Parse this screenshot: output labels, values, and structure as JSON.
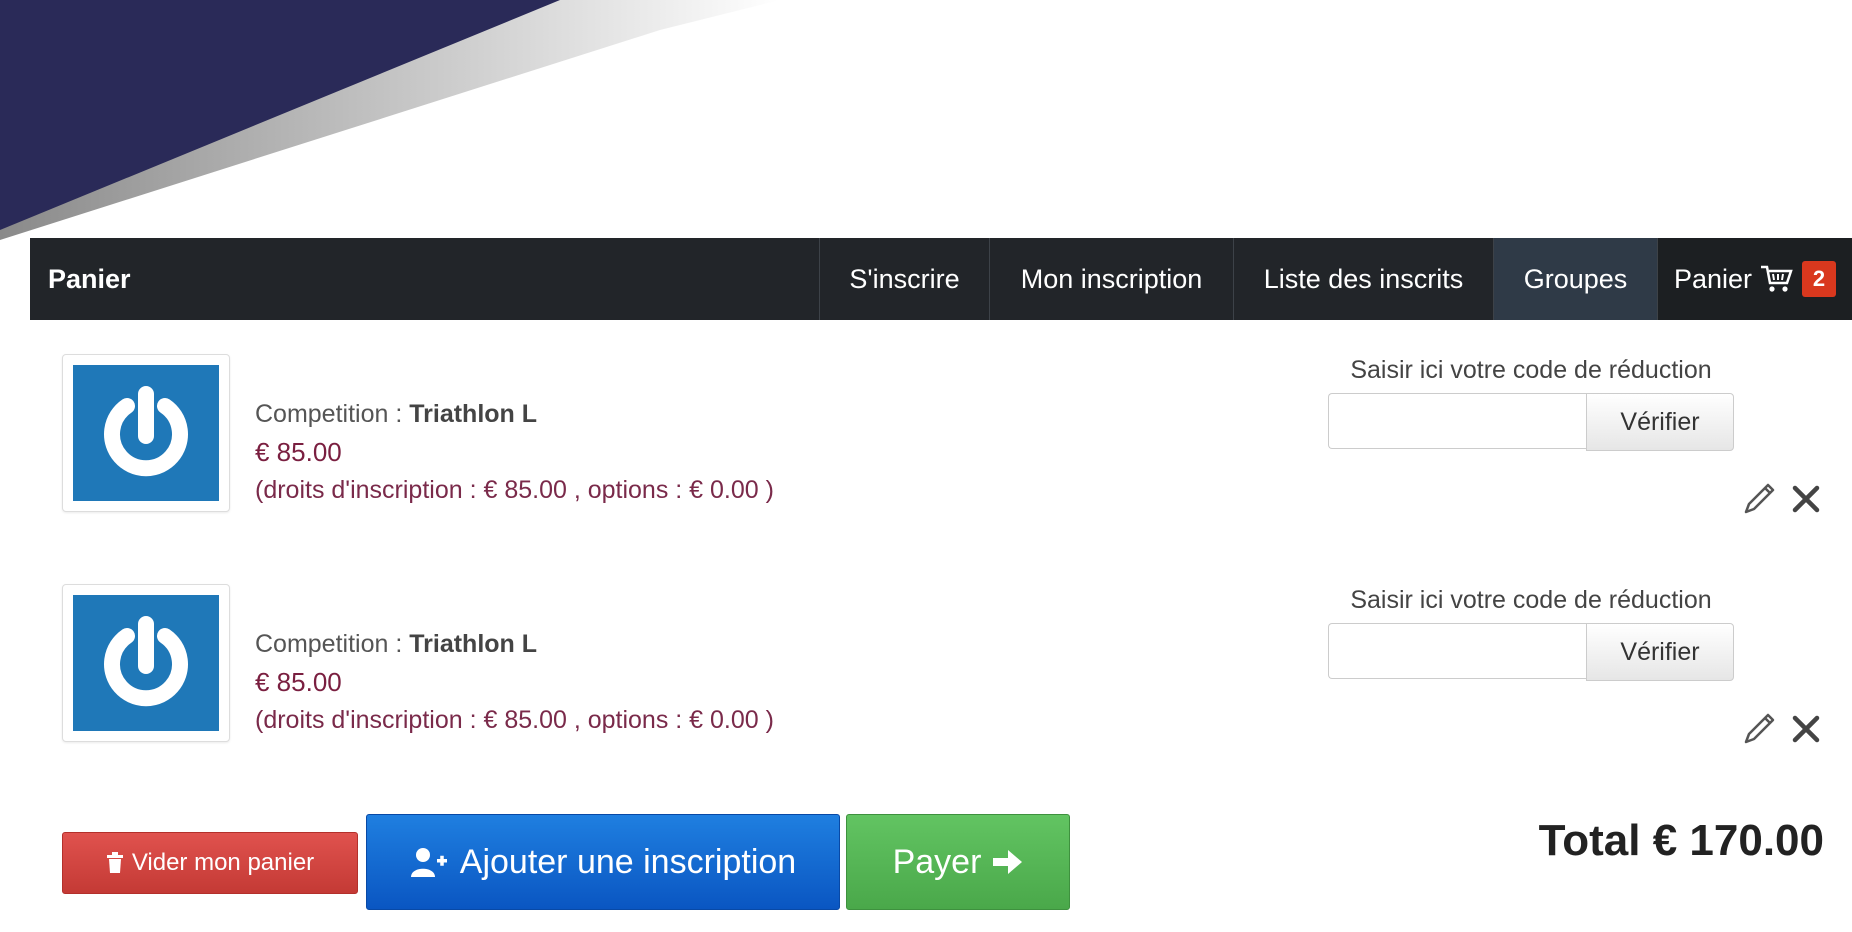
{
  "navbar": {
    "brand": "Panier",
    "items": [
      {
        "label": "S'inscrire"
      },
      {
        "label": "Mon inscription"
      },
      {
        "label": "Liste des inscrits"
      },
      {
        "label": "Groupes"
      },
      {
        "label": "Panier",
        "badge": "2"
      }
    ]
  },
  "cart": {
    "items": [
      {
        "competition_prefix": "Competition :",
        "competition_name": "Triathlon L",
        "price": "€ 85.00",
        "details": "(droits d'inscription : € 85.00 , options : € 0.00 )",
        "discount_label": "Saisir ici votre code de réduction",
        "discount_value": "",
        "verify_label": "Vérifier"
      },
      {
        "competition_prefix": "Competition :",
        "competition_name": "Triathlon L",
        "price": "€ 85.00",
        "details": "(droits d'inscription : € 85.00 , options : € 0.00 )",
        "discount_label": "Saisir ici votre code de réduction",
        "discount_value": "",
        "verify_label": "Vérifier"
      }
    ],
    "empty_label": "Vider mon panier",
    "add_label": "Ajouter une inscription",
    "pay_label": "Payer",
    "total": "Total € 170.00"
  },
  "colors": {
    "navbar_bg": "#222529",
    "badge": "#d9381e",
    "logo_bg": "#1f78b8",
    "price_text": "#7a1f40",
    "btn_danger": "#d9534f",
    "btn_primary": "#0a56c2",
    "btn_success": "#5cb85c"
  },
  "icons": {
    "cart": "shopping-cart-icon",
    "logo": "power-ring-icon",
    "edit": "pencil-icon",
    "remove": "close-icon",
    "trash": "trash-icon",
    "add_user": "add-user-icon",
    "arrow": "arrow-right-icon"
  }
}
